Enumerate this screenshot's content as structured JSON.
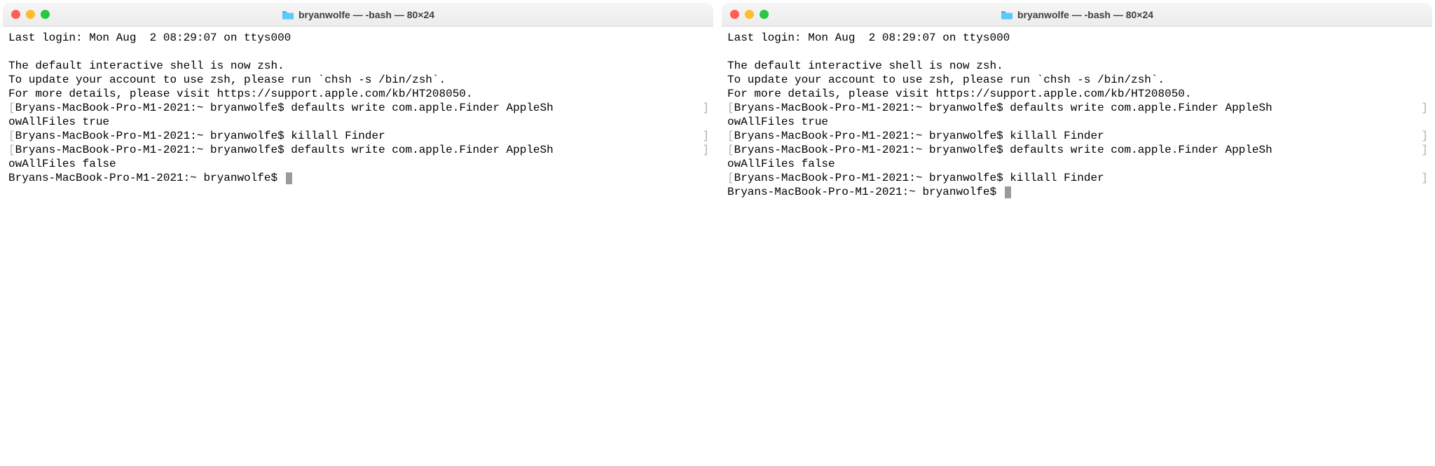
{
  "window_title": "bryanwolfe — -bash — 80×24",
  "left": {
    "lines": [
      {
        "type": "plain",
        "text": "Last login: Mon Aug  2 08:29:07 on ttys000"
      },
      {
        "type": "blank"
      },
      {
        "type": "plain",
        "text": "The default interactive shell is now zsh."
      },
      {
        "type": "plain",
        "text": "To update your account to use zsh, please run `chsh -s /bin/zsh`."
      },
      {
        "type": "plain",
        "text": "For more details, please visit https://support.apple.com/kb/HT208050."
      },
      {
        "type": "bracketed",
        "text": "Bryans-MacBook-Pro-M1-2021:~ bryanwolfe$ defaults write com.apple.Finder AppleSh"
      },
      {
        "type": "plain",
        "text": "owAllFiles true"
      },
      {
        "type": "bracketed",
        "text": "Bryans-MacBook-Pro-M1-2021:~ bryanwolfe$ killall Finder"
      },
      {
        "type": "bracketed",
        "text": "Bryans-MacBook-Pro-M1-2021:~ bryanwolfe$ defaults write com.apple.Finder AppleSh"
      },
      {
        "type": "plain",
        "text": "owAllFiles false"
      },
      {
        "type": "prompt",
        "text": "Bryans-MacBook-Pro-M1-2021:~ bryanwolfe$ "
      }
    ]
  },
  "right": {
    "lines": [
      {
        "type": "plain",
        "text": "Last login: Mon Aug  2 08:29:07 on ttys000"
      },
      {
        "type": "blank"
      },
      {
        "type": "plain",
        "text": "The default interactive shell is now zsh."
      },
      {
        "type": "plain",
        "text": "To update your account to use zsh, please run `chsh -s /bin/zsh`."
      },
      {
        "type": "plain",
        "text": "For more details, please visit https://support.apple.com/kb/HT208050."
      },
      {
        "type": "bracketed",
        "text": "Bryans-MacBook-Pro-M1-2021:~ bryanwolfe$ defaults write com.apple.Finder AppleSh"
      },
      {
        "type": "plain",
        "text": "owAllFiles true"
      },
      {
        "type": "bracketed",
        "text": "Bryans-MacBook-Pro-M1-2021:~ bryanwolfe$ killall Finder"
      },
      {
        "type": "bracketed",
        "text": "Bryans-MacBook-Pro-M1-2021:~ bryanwolfe$ defaults write com.apple.Finder AppleSh"
      },
      {
        "type": "plain",
        "text": "owAllFiles false"
      },
      {
        "type": "bracketed",
        "text": "Bryans-MacBook-Pro-M1-2021:~ bryanwolfe$ killall Finder"
      },
      {
        "type": "prompt",
        "text": "Bryans-MacBook-Pro-M1-2021:~ bryanwolfe$ "
      }
    ]
  }
}
